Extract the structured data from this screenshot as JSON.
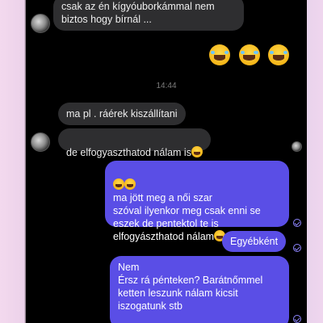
{
  "chat": {
    "msg1": "csak az én kígyóuborkámmal nem\nbiztos hogy bírnál ...",
    "timestamp": "14:44",
    "msg2": "ma pl . ráérek kiszállítani",
    "msg3": "de elfogyaszthatod nálam is",
    "msg4": "ma jött meg a női szar\nszóval ilyenkor meg csak enni se\neszek de pentektol te is\nelfogyászthatod nálam",
    "msg5": "Egyébként",
    "msg6": "Nem\nÉrsz rá pénteken? Barátnőmmel\nketten leszunk nálam kicsit\niszogatunk stb"
  },
  "colors": {
    "incoming": "#2e2e30",
    "outgoing": "#5a4ee6",
    "background": "#000000"
  },
  "icons": [
    "laughing-tears-emoji",
    "grinning-sweat-emoji",
    "read-check-icon",
    "avatar"
  ]
}
